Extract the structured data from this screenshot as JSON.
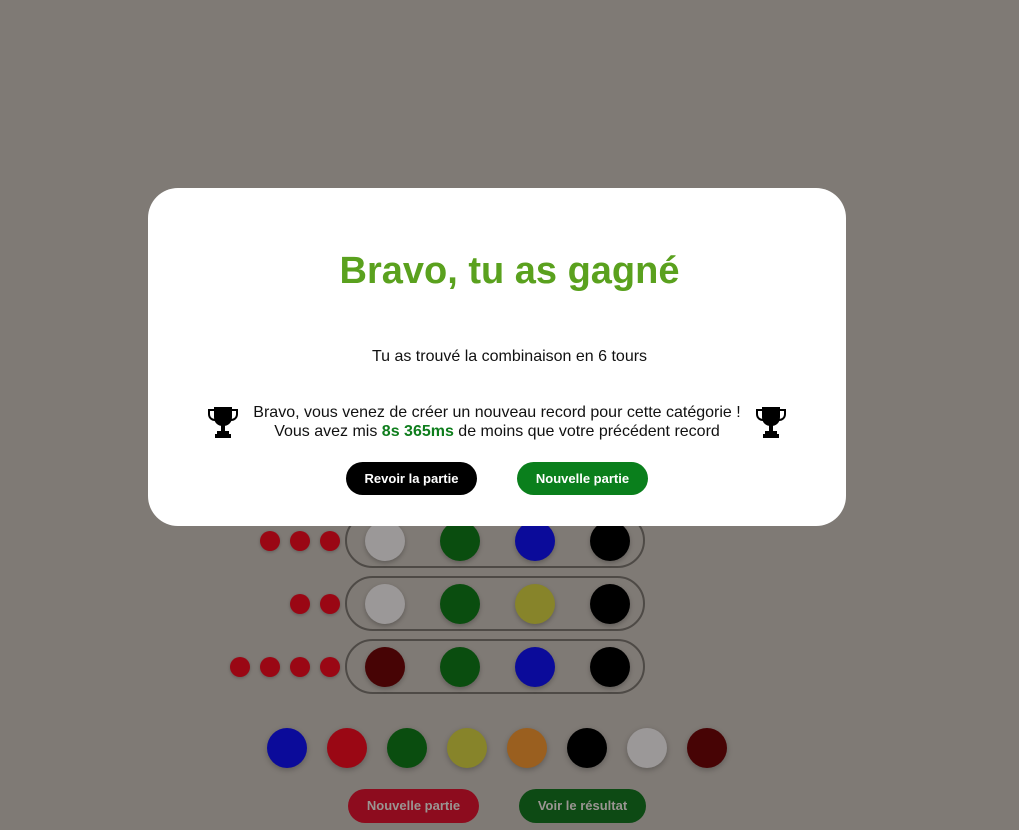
{
  "modal": {
    "title": "Bravo, tu as gagné",
    "subtitle": "Tu as trouvé la combinaison en 6 tours",
    "record_line1": "Bravo, vous venez de créer un nouveau record pour cette catégorie !",
    "record_line2_prefix": "Vous avez mis ",
    "record_time": "8s 365ms",
    "record_line2_suffix": " de moins que votre précédent record",
    "replay_button": "Revoir la partie",
    "new_game_button": "Nouvelle partie",
    "trophy_icon": "trophy-icon"
  },
  "board": {
    "rows": [
      {
        "hints": [
          "red",
          "red",
          "red"
        ],
        "pegs": [
          "silver",
          "green",
          "blue",
          "black"
        ]
      },
      {
        "hints": [
          "red",
          "red"
        ],
        "pegs": [
          "silver",
          "green",
          "yellow",
          "black"
        ]
      },
      {
        "hints": [
          "red",
          "red",
          "red",
          "red"
        ],
        "pegs": [
          "maroon",
          "green",
          "blue",
          "black"
        ]
      }
    ]
  },
  "palette": [
    "blue",
    "red",
    "green",
    "yellow",
    "orange",
    "black",
    "silver",
    "maroon"
  ],
  "footer": {
    "new_game_button": "Nouvelle partie",
    "show_result_button": "Voir le résultat"
  },
  "colors": {
    "overlay_bg": "#7f7a75",
    "title_green": "#5aa11e",
    "record_time_green": "#0e7d1c",
    "replay_button_bg": "#000000",
    "new_game_button_bg": "#0a7f1c",
    "footer_new_game_bg": "#8d0c1e",
    "footer_result_bg": "#0d4a14",
    "peg_colors": {
      "blue": "#0b0b9a",
      "red": "#9a0714",
      "green": "#0a4d0f",
      "yellow": "#87842a",
      "orange": "#9a5f1f",
      "black": "#000000",
      "silver": "#9b9898",
      "maroon": "#470405"
    },
    "hint_red": "#9a0714"
  }
}
